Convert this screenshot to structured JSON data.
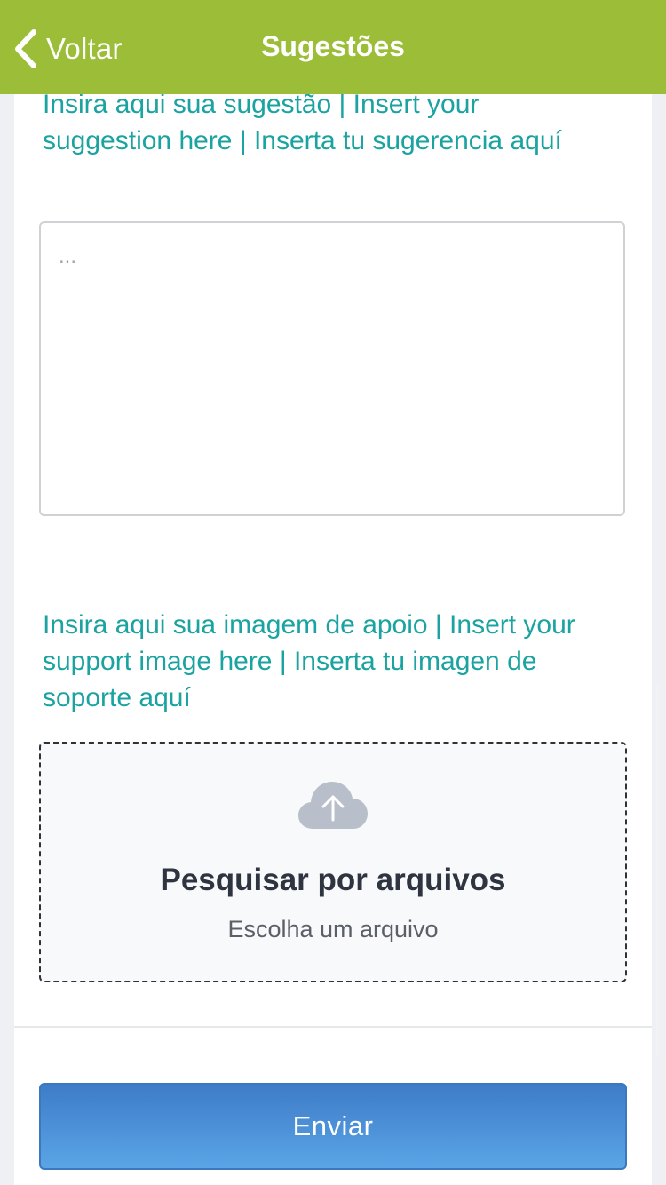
{
  "nav": {
    "back_label": "Voltar",
    "title": "Sugestões"
  },
  "suggestion": {
    "label": "Insira aqui sua sugestão | Insert your suggestion here | Inserta tu sugerencia aquí",
    "placeholder": "...",
    "value": ""
  },
  "support_image": {
    "label": "Insira aqui sua imagem de apoio | Insert your support image here | Inserta tu imagen de soporte aquí",
    "browse_title": "Pesquisar por arquivos",
    "browse_subtitle": "Escolha um arquivo",
    "icon": "cloud-upload-icon"
  },
  "submit": {
    "label": "Enviar"
  },
  "colors": {
    "navbar": "#9cbd38",
    "label_teal": "#1aa3a0",
    "button_blue": "#4a8fd8",
    "upload_icon": "#b8bfca"
  }
}
